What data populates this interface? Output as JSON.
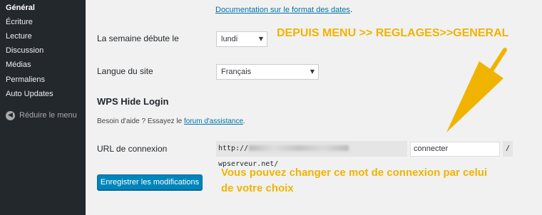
{
  "sidebar": {
    "items": [
      {
        "label": "Général",
        "current": true
      },
      {
        "label": "Écriture"
      },
      {
        "label": "Lecture"
      },
      {
        "label": "Discussion"
      },
      {
        "label": "Médias"
      },
      {
        "label": "Permaliens"
      },
      {
        "label": "Auto Updates"
      }
    ],
    "collapse_label": "Réduire le menu",
    "collapse_icon": "arrow-left-circle-icon"
  },
  "main": {
    "date_doc_link": "Documentation sur le format des dates",
    "date_doc_suffix": ".",
    "week_start": {
      "label": "La semaine débute le",
      "value": "lundi"
    },
    "site_language": {
      "label": "Langue du site",
      "value": "Français"
    },
    "wps_section": {
      "title": "WPS Hide Login",
      "help_prefix": "Besoin d'aide ? Essayez le ",
      "help_link": "forum d'assistance",
      "help_suffix": "."
    },
    "login_url": {
      "label": "URL de connexion",
      "prefix_start": "http://",
      "prefix_end": "wpserveur.net/",
      "value": "connecter",
      "suffix": "/"
    },
    "save_button": "Enregistrer les modifications"
  },
  "annotations": {
    "top": "DEPUIS MENU >> REGLAGES>>GENERAL",
    "bottom_line1": "Vous pouvez changer ce mot de connexion par celui",
    "bottom_line2": "de votre choix",
    "color": "#f0b400"
  }
}
